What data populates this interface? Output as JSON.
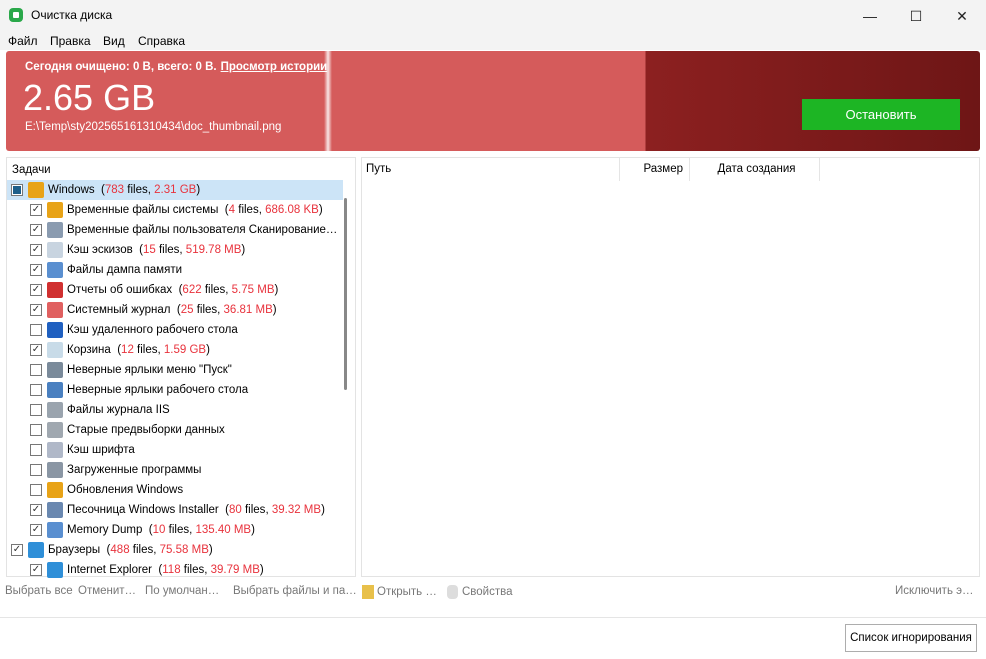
{
  "window": {
    "title": "Очистка диска",
    "controls": [
      "—",
      "☐",
      "✕"
    ]
  },
  "menu": [
    "Файл",
    "Правка",
    "Вид",
    "Справка"
  ],
  "banner": {
    "stat": "Сегодня очищено: 0 B, всего: 0 B.",
    "history_link": "Просмотр истории",
    "size": "2.65 GB",
    "path": "E:\\Temp\\sty202565161310434\\doc_thumbnail.png",
    "stop_label": "Остановить"
  },
  "tasks": {
    "header": "Задачи",
    "rows": [
      {
        "label": "Windows",
        "files": "783",
        "size": "2.31 GB",
        "state": "partial",
        "level": 0,
        "icon": "windows-icon",
        "color": "#e8a317"
      },
      {
        "label": "Временные файлы системы",
        "files": "4",
        "size": "686.08 KB",
        "state": "checked",
        "level": 1,
        "icon": "windows-icon",
        "color": "#e8a317"
      },
      {
        "label": "Временные файлы пользователя  Сканирование…",
        "state": "checked",
        "level": 1,
        "icon": "user-files-icon",
        "color": "#8a9bb0"
      },
      {
        "label": "Кэш эскизов",
        "files": "15",
        "size": "519.78 MB",
        "state": "checked",
        "level": 1,
        "icon": "thumbnail-icon",
        "color": "#c8d4e0"
      },
      {
        "label": "Файлы дампа памяти",
        "state": "checked",
        "level": 1,
        "icon": "memory-dump-icon",
        "color": "#5a8fd0"
      },
      {
        "label": "Отчеты об ошибках",
        "files": "622",
        "size": "5.75 MB",
        "state": "checked",
        "level": 1,
        "icon": "error-report-icon",
        "color": "#d03030"
      },
      {
        "label": "Системный журнал",
        "files": "25",
        "size": "36.81 MB",
        "state": "checked",
        "level": 1,
        "icon": "system-log-icon",
        "color": "#e06060"
      },
      {
        "label": "Кэш удаленного рабочего стола",
        "state": "unchecked",
        "level": 1,
        "icon": "remote-desktop-icon",
        "color": "#2060c0"
      },
      {
        "label": "Корзина",
        "files": "12",
        "size": "1.59 GB",
        "state": "checked",
        "level": 1,
        "icon": "recycle-bin-icon",
        "color": "#c8dbe8"
      },
      {
        "label": "Неверные ярлыки меню \"Пуск\"",
        "state": "unchecked",
        "level": 1,
        "icon": "shortcut-icon",
        "color": "#7a8a9a"
      },
      {
        "label": "Неверные ярлыки рабочего стола",
        "state": "unchecked",
        "level": 1,
        "icon": "desktop-shortcut-icon",
        "color": "#4a80c0"
      },
      {
        "label": "Файлы журнала IIS",
        "state": "unchecked",
        "level": 1,
        "icon": "iis-log-icon",
        "color": "#9aa4ae"
      },
      {
        "label": "Старые предвыборки данных",
        "state": "unchecked",
        "level": 1,
        "icon": "prefetch-icon",
        "color": "#a0a8b0"
      },
      {
        "label": "Кэш шрифта",
        "state": "unchecked",
        "level": 1,
        "icon": "font-icon",
        "color": "#b0b8c8"
      },
      {
        "label": "Загруженные программы",
        "state": "unchecked",
        "level": 1,
        "icon": "programs-icon",
        "color": "#8a96a4"
      },
      {
        "label": "Обновления Windows",
        "state": "unchecked",
        "level": 1,
        "icon": "windows-update-icon",
        "color": "#e8a317"
      },
      {
        "label": "Песочница Windows Installer",
        "files": "80",
        "size": "39.32 MB",
        "state": "checked",
        "level": 1,
        "icon": "installer-icon",
        "color": "#6a88b0"
      },
      {
        "label": "Memory Dump",
        "files": "10",
        "size": "135.40 MB",
        "state": "checked",
        "level": 1,
        "icon": "memory-dump-icon",
        "color": "#5a8fd0"
      },
      {
        "label": "Браузеры",
        "files": "488",
        "size": "75.58 MB",
        "state": "checked",
        "level": 0,
        "icon": "globe-icon",
        "color": "#2f8fd8"
      },
      {
        "label": "Internet Explorer",
        "files": "118",
        "size": "39.79 MB",
        "state": "checked",
        "level": 1,
        "icon": "ie-icon",
        "color": "#2f8fd8"
      }
    ]
  },
  "files_word": "files",
  "table": {
    "columns": [
      "Путь",
      "Размер",
      "Дата создания"
    ]
  },
  "toolbar": {
    "select_all": "Выбрать все",
    "cancel": "Отменит…",
    "default": "По умолчан…",
    "select_files": "Выбрать файлы и па…",
    "open": "Открыть …",
    "properties": "Свойства",
    "exclude": "Исключить э…"
  },
  "ignore_label": "Список игнорирования"
}
